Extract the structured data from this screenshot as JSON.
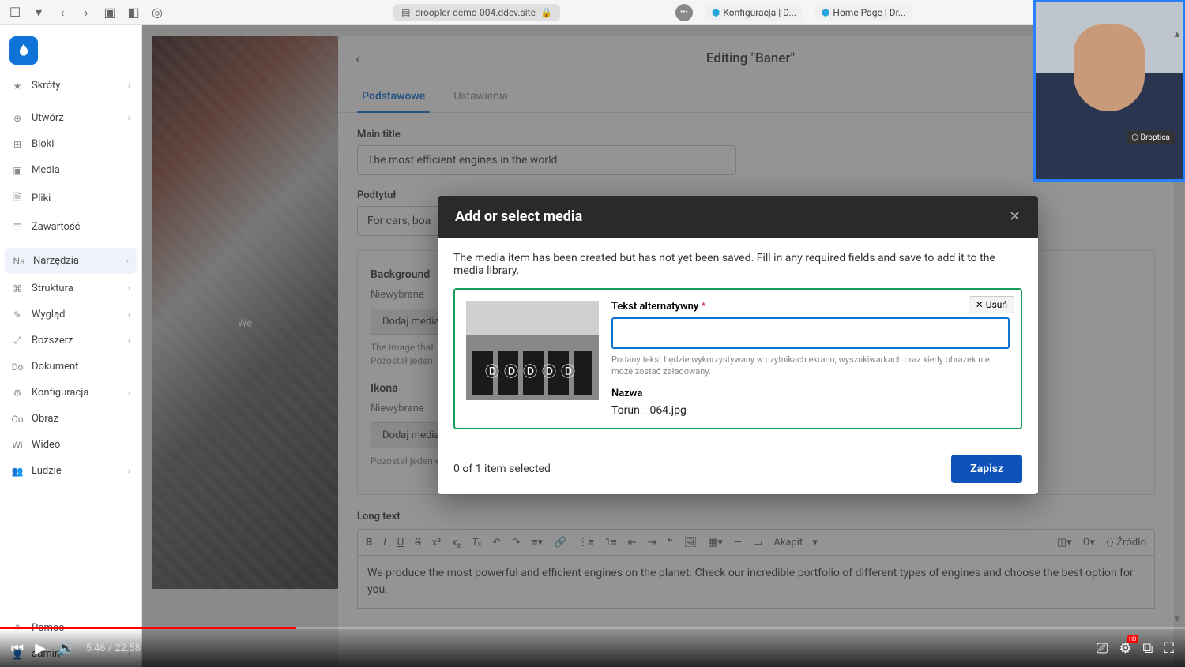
{
  "browser": {
    "address": "droopler-demo-004.ddev.site",
    "tabs": [
      {
        "label": "Konfiguracja | D..."
      },
      {
        "label": "Home Page | Dr..."
      }
    ]
  },
  "sidebar": {
    "items": [
      {
        "icon": "★",
        "label": "Skróty",
        "chev": true
      },
      {
        "icon": "⊕",
        "label": "Utwórz",
        "chev": true
      },
      {
        "icon": "⊞",
        "label": "Bloki",
        "chev": false
      },
      {
        "icon": "▣",
        "label": "Media",
        "chev": false
      },
      {
        "icon": "🗎",
        "label": "Pliki",
        "chev": false
      },
      {
        "icon": "☰",
        "label": "Zawartość",
        "chev": false
      },
      {
        "icon": "Na",
        "label": "Narzędzia",
        "chev": true,
        "active": true
      },
      {
        "icon": "⌘",
        "label": "Struktura",
        "chev": true
      },
      {
        "icon": "✎",
        "label": "Wygląd",
        "chev": true
      },
      {
        "icon": "⤢",
        "label": "Rozszerz",
        "chev": true
      },
      {
        "icon": "Do",
        "label": "Dokument",
        "chev": false
      },
      {
        "icon": "⚙",
        "label": "Konfiguracja",
        "chev": true
      },
      {
        "icon": "Oo",
        "label": "Obraz",
        "chev": false
      },
      {
        "icon": "Wi",
        "label": "Wideo",
        "chev": false
      },
      {
        "icon": "👥",
        "label": "Ludzie",
        "chev": true
      }
    ],
    "bottom": [
      {
        "icon": "?",
        "label": "Pomoc"
      },
      {
        "icon": "👤",
        "label": "admin",
        "chev": true
      }
    ]
  },
  "preview_caption": "We",
  "editor": {
    "title": "Editing \"Baner\"",
    "tabs": {
      "basic": "Podstawowe",
      "settings": "Ustawienia"
    },
    "main_title_label": "Main title",
    "main_title_value": "The most efficient engines in the world",
    "subtitle_label": "Podtytuł",
    "subtitle_value": "For cars, boa",
    "bg_label": "Background",
    "not_selected": "Niewybrane",
    "add_media_btn": "Dodaj media",
    "bg_help1": "The image that",
    "bg_help2": "Pozostał jeden",
    "icon_label": "Ikona",
    "icon_status": "Niewybrane",
    "icon_help": "Pozostał jeden element mediów",
    "longtext_label": "Long text",
    "rte_format": "Akapit",
    "rte_source": "Źródło",
    "rte_text": "We produce the most powerful and efficient engines on the planet. Check our incredible portfolio of different types of engines and choose the best option for you."
  },
  "modal": {
    "title": "Add or select media",
    "info": "The media item has been created but has not yet been saved. Fill in any required fields and save to add it to the media library.",
    "alt_label": "Tekst alternatywny",
    "alt_help": "Podany tekst będzie wykorzystywany w czytnikach ekranu, wyszukiwarkach oraz kiedy obrazek nie może zostać załadowany.",
    "name_label": "Nazwa",
    "name_value": "Torun__064.jpg",
    "remove_btn": "Usuń",
    "selected": "0 of 1 item selected",
    "save": "Zapisz"
  },
  "webcam_badge": "⬡ Droptica",
  "video": {
    "current": "5:46",
    "total": "22:58"
  }
}
